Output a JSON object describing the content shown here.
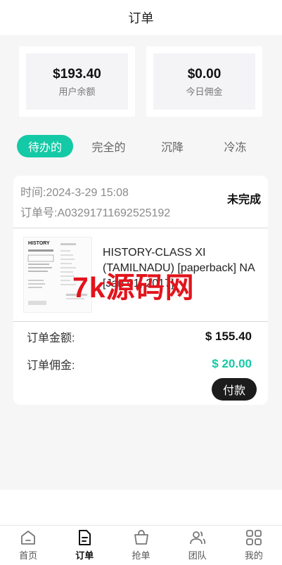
{
  "header": {
    "title": "订单"
  },
  "stats": {
    "balance": {
      "value": "$193.40",
      "label": "用户余额"
    },
    "commission": {
      "value": "$0.00",
      "label": "今日佣金"
    }
  },
  "tabs": [
    {
      "label": "待办的",
      "active": true
    },
    {
      "label": "完全的",
      "active": false
    },
    {
      "label": "沉降",
      "active": false
    },
    {
      "label": "冷冻",
      "active": false
    }
  ],
  "order": {
    "time": "时间:2024-3-29 15:08",
    "order_no": "订单号:A03291711692525192",
    "status": "未完成",
    "product_title": "HISTORY-CLASS XI (TAMILNADU) [paperback] NA [Jan 01, 2017]",
    "amount_label": "订单金额:",
    "amount_value": "$ 155.40",
    "commission_label": "订单佣金:",
    "commission_value": "$ 20.00",
    "pay_label": "付款"
  },
  "book_cover": {
    "title": "HISTORY"
  },
  "watermark": "7k源码网",
  "tabbar": [
    {
      "label": "首页",
      "icon": "home-icon",
      "active": false
    },
    {
      "label": "订单",
      "icon": "order-icon",
      "active": true
    },
    {
      "label": "抢单",
      "icon": "bag-icon",
      "active": false
    },
    {
      "label": "团队",
      "icon": "team-icon",
      "active": false
    },
    {
      "label": "我的",
      "icon": "grid-icon",
      "active": false
    }
  ],
  "colors": {
    "accent": "#14c9a6",
    "dark": "#1c1c1c",
    "watermark": "#e2141c"
  }
}
